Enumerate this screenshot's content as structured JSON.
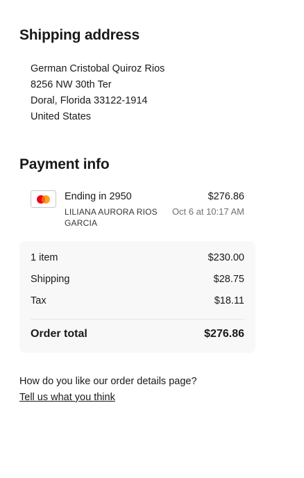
{
  "shipping": {
    "title": "Shipping address",
    "address_lines": [
      "German Cristobal Quiroz Rios",
      "8256 NW 30th Ter",
      "Doral, Florida 33122-1914",
      "United States"
    ]
  },
  "payment": {
    "title": "Payment info",
    "card_icon": "mastercard-icon",
    "card_ending": "Ending in 2950",
    "card_holder": "LILIANA AURORA RIOS GARCIA",
    "amount": "$276.86",
    "datetime": "Oct 6 at 10:17 AM"
  },
  "summary": {
    "rows": [
      {
        "label": "1 item",
        "value": "$230.00"
      },
      {
        "label": "Shipping",
        "value": "$28.75"
      },
      {
        "label": "Tax",
        "value": "$18.11"
      }
    ],
    "total_label": "Order total",
    "total_value": "$276.86"
  },
  "feedback": {
    "question": "How do you like our order details page?",
    "link": "Tell us what you think"
  }
}
